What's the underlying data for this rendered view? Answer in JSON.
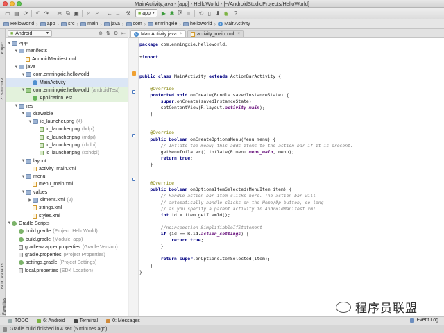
{
  "window": {
    "title": "MainActivity.java - [app] - HelloWorld - [~/AndroidStudioProjects/HelloWorld]"
  },
  "toolbar": {
    "run_config": "app"
  },
  "breadcrumbs": [
    "HelloWorld",
    "app",
    "src",
    "main",
    "java",
    "com",
    "enmingxie",
    "helloworld",
    "MainActivity"
  ],
  "left_tabs": [
    "1: Project",
    "2: Structure",
    "Build Variants",
    "2: Favorites"
  ],
  "project": {
    "view_mode": "Android",
    "tree": [
      {
        "depth": 0,
        "label": "app",
        "icon": "folder",
        "expanded": true
      },
      {
        "depth": 1,
        "label": "manifests",
        "icon": "folder",
        "expanded": true
      },
      {
        "depth": 2,
        "label": "AndroidManifest.xml",
        "icon": "xml"
      },
      {
        "depth": 1,
        "label": "java",
        "icon": "folder",
        "expanded": true
      },
      {
        "depth": 2,
        "label": "com.enmingxie.helloworld",
        "icon": "folder",
        "expanded": true
      },
      {
        "depth": 3,
        "label": "MainActivity",
        "icon": "class",
        "selected": true
      },
      {
        "depth": 2,
        "label": "com.enmingxie.helloworld",
        "hint": "(androidTest)",
        "icon": "folder-green",
        "expanded": true,
        "test": true
      },
      {
        "depth": 3,
        "label": "ApplicationTest",
        "icon": "class-green",
        "test": true
      },
      {
        "depth": 1,
        "label": "res",
        "icon": "folder",
        "expanded": true
      },
      {
        "depth": 2,
        "label": "drawable",
        "icon": "folder",
        "expanded": true
      },
      {
        "depth": 3,
        "label": "ic_launcher.png",
        "hint": "(4)",
        "icon": "folder",
        "expanded": true
      },
      {
        "depth": 4,
        "label": "ic_launcher.png",
        "hint": "(hdpi)",
        "icon": "png"
      },
      {
        "depth": 4,
        "label": "ic_launcher.png",
        "hint": "(mdpi)",
        "icon": "png"
      },
      {
        "depth": 4,
        "label": "ic_launcher.png",
        "hint": "(xhdpi)",
        "icon": "png"
      },
      {
        "depth": 4,
        "label": "ic_launcher.png",
        "hint": "(xxhdpi)",
        "icon": "png"
      },
      {
        "depth": 2,
        "label": "layout",
        "icon": "folder",
        "expanded": true
      },
      {
        "depth": 3,
        "label": "activity_main.xml",
        "icon": "xml"
      },
      {
        "depth": 2,
        "label": "menu",
        "icon": "folder",
        "expanded": true
      },
      {
        "depth": 3,
        "label": "menu_main.xml",
        "icon": "xml"
      },
      {
        "depth": 2,
        "label": "values",
        "icon": "folder",
        "expanded": true
      },
      {
        "depth": 3,
        "label": "dimens.xml",
        "hint": "(2)",
        "icon": "folder",
        "expanded": false
      },
      {
        "depth": 3,
        "label": "strings.xml",
        "icon": "xml"
      },
      {
        "depth": 3,
        "label": "styles.xml",
        "icon": "xml"
      },
      {
        "depth": 0,
        "label": "Gradle Scripts",
        "icon": "gradle",
        "expanded": true
      },
      {
        "depth": 1,
        "label": "build.gradle",
        "hint": "(Project: HelloWorld)",
        "icon": "gradle"
      },
      {
        "depth": 1,
        "label": "build.gradle",
        "hint": "(Module: app)",
        "icon": "gradle"
      },
      {
        "depth": 1,
        "label": "gradle-wrapper.properties",
        "hint": "(Gradle Version)",
        "icon": "props"
      },
      {
        "depth": 1,
        "label": "gradle.properties",
        "hint": "(Project Properties)",
        "icon": "props"
      },
      {
        "depth": 1,
        "label": "settings.gradle",
        "hint": "(Project Settings)",
        "icon": "gradle"
      },
      {
        "depth": 1,
        "label": "local.properties",
        "hint": "(SDK Location)",
        "icon": "props"
      }
    ]
  },
  "editor": {
    "tabs": [
      {
        "label": "MainActivity.java",
        "active": true
      },
      {
        "label": "activity_main.xml",
        "active": false
      }
    ],
    "lines": [
      [
        [
          "kw",
          "package "
        ],
        [
          "",
          "com.enmingxie.helloworld;"
        ]
      ],
      [],
      [
        [
          "",
          "+"
        ],
        [
          "kw",
          "import"
        ],
        [
          "",
          " ..."
        ]
      ],
      [],
      [],
      [
        [
          "kw",
          "public class "
        ],
        [
          "",
          "MainActivity "
        ],
        [
          "kw",
          "extends "
        ],
        [
          "",
          "ActionBarActivity {"
        ]
      ],
      [],
      [
        [
          "ann",
          "    @Override"
        ]
      ],
      [
        [
          "kw",
          "    protected void "
        ],
        [
          "",
          "onCreate(Bundle savedInstanceState) {"
        ]
      ],
      [
        [
          "kw",
          "        super"
        ],
        [
          "",
          ".onCreate(savedInstanceState);"
        ]
      ],
      [
        [
          "",
          "        setContentView(R.layout."
        ],
        [
          "fld",
          "activity_main"
        ],
        [
          "",
          ");"
        ]
      ],
      [
        [
          "",
          "    }"
        ]
      ],
      [],
      [],
      [
        [
          "ann",
          "    @Override"
        ]
      ],
      [
        [
          "kw",
          "    public boolean "
        ],
        [
          "",
          "onCreateOptionsMenu(Menu menu) {"
        ]
      ],
      [
        [
          "cmt",
          "        // Inflate the menu; this adds items to the action bar if it is present."
        ]
      ],
      [
        [
          "",
          "        getMenuInflater().inflate(R.menu."
        ],
        [
          "fld",
          "menu_main"
        ],
        [
          "",
          ", menu);"
        ]
      ],
      [
        [
          "kw",
          "        return true"
        ],
        [
          "",
          ";"
        ]
      ],
      [
        [
          "",
          "    }"
        ]
      ],
      [],
      [],
      [
        [
          "ann",
          "    @Override"
        ]
      ],
      [
        [
          "kw",
          "    public boolean "
        ],
        [
          "",
          "onOptionsItemSelected(MenuItem item) {"
        ]
      ],
      [
        [
          "cmt",
          "        // Handle action bar item clicks here. The action bar will"
        ]
      ],
      [
        [
          "cmt",
          "        // automatically handle clicks on the Home/Up button, so long"
        ]
      ],
      [
        [
          "cmt",
          "        // as you specify a parent activity in AndroidManifest.xml."
        ]
      ],
      [
        [
          "kw",
          "        int "
        ],
        [
          "",
          "id = item.getItemId();"
        ]
      ],
      [],
      [
        [
          "cmt",
          "        //noinspection SimplifiableIfStatement"
        ]
      ],
      [
        [
          "kw",
          "        if "
        ],
        [
          "",
          "(id == R.id."
        ],
        [
          "fld",
          "action_settings"
        ],
        [
          "",
          ") {"
        ]
      ],
      [
        [
          "kw",
          "            return true"
        ],
        [
          "",
          ";"
        ]
      ],
      [
        [
          "",
          "        }"
        ]
      ],
      [],
      [
        [
          "kw",
          "        return super"
        ],
        [
          "",
          ".onOptionsItemSelected(item);"
        ]
      ],
      [
        [
          "",
          "    }"
        ]
      ],
      [
        [
          "",
          "}"
        ]
      ]
    ]
  },
  "bottom_tools": [
    {
      "label": "TODO",
      "icon": "todo-icon"
    },
    {
      "label": "6: Android",
      "icon": "android-icon"
    },
    {
      "label": "Terminal",
      "icon": "terminal-icon"
    },
    {
      "label": "0: Messages",
      "icon": "messages-icon"
    }
  ],
  "event_log": "Event Log",
  "status": "Gradle build finished in 4 sec (5 minutes ago)",
  "watermark": "程序员联盟"
}
